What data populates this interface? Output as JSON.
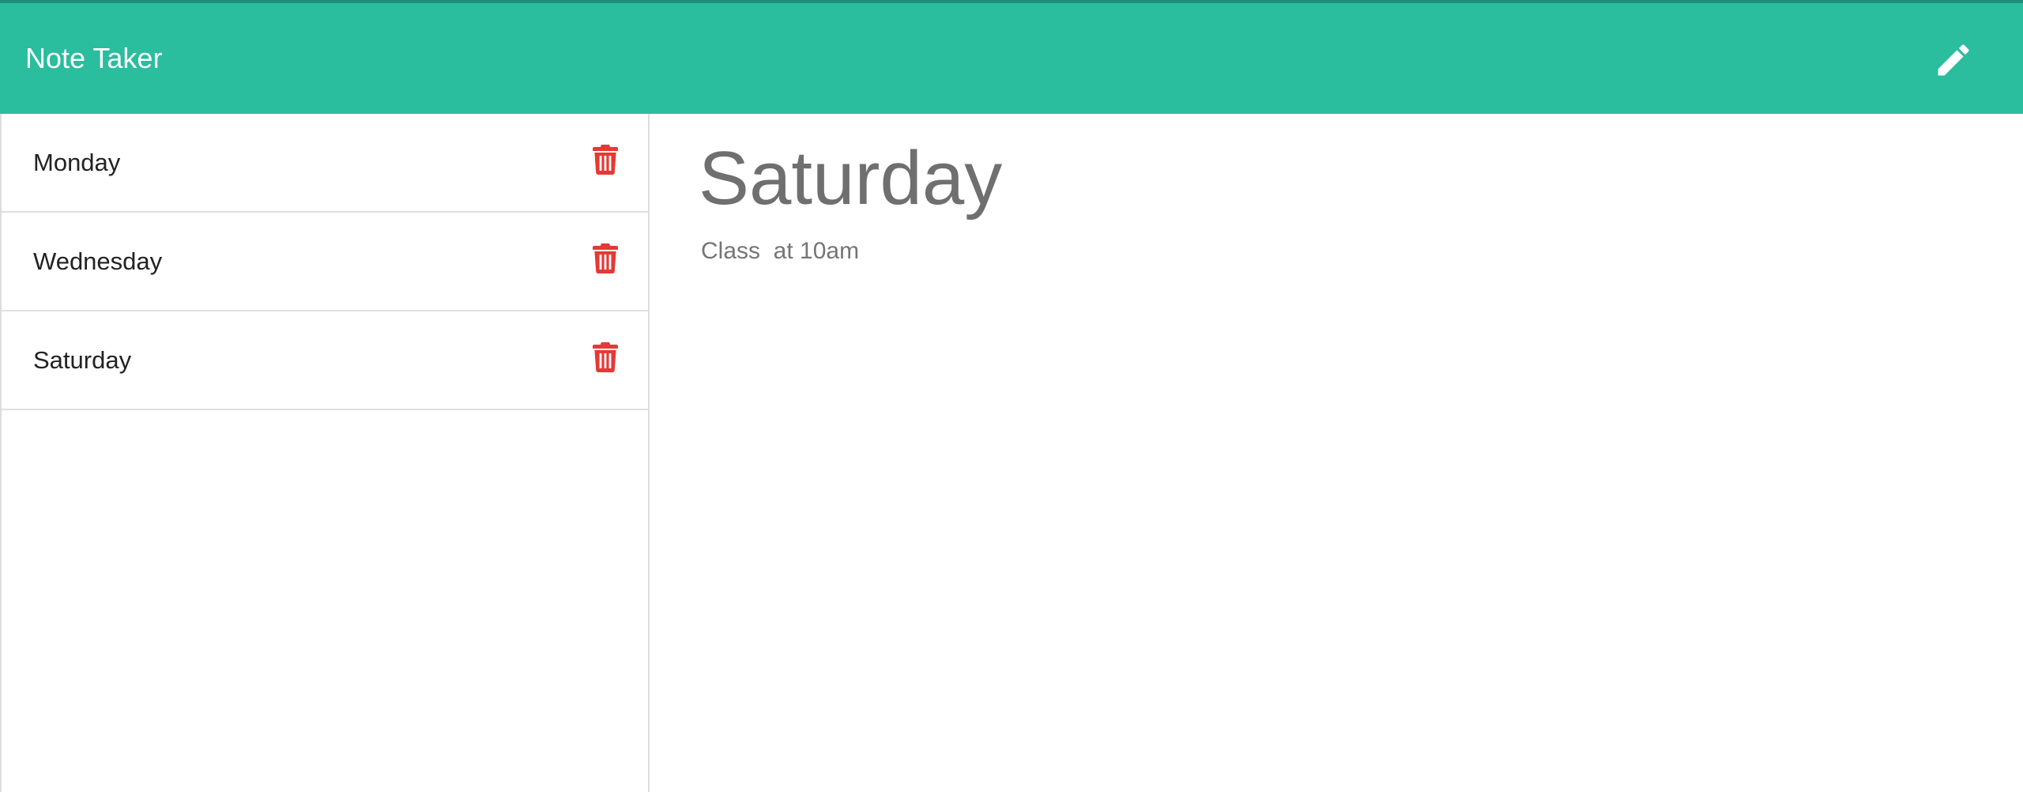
{
  "header": {
    "title": "Note Taker",
    "new_note_icon": "pencil-icon",
    "background_color": "#2abd9e"
  },
  "sidebar": {
    "notes": [
      {
        "title": "Monday",
        "delete_icon": "trash-icon"
      },
      {
        "title": "Wednesday",
        "delete_icon": "trash-icon"
      },
      {
        "title": "Saturday",
        "delete_icon": "trash-icon"
      }
    ],
    "delete_color": "#e53935"
  },
  "main": {
    "note_title": "Saturday",
    "note_text": "Class  at 10am"
  }
}
